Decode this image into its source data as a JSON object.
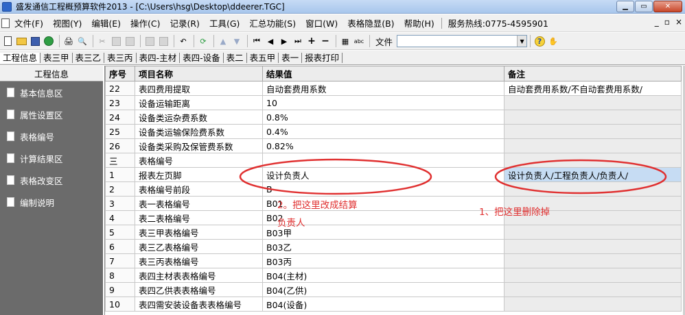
{
  "window": {
    "title": "盛发通信工程概预算软件2013 - [C:\\Users\\hsg\\Desktop\\ddeerer.TGC]",
    "buttons": {
      "minimize": "▁",
      "maximize": "▭",
      "close": "✕"
    }
  },
  "menu": {
    "items": [
      "文件(F)",
      "视图(Y)",
      "编辑(E)",
      "操作(C)",
      "记录(R)",
      "工具(G)",
      "汇总功能(S)",
      "窗口(W)",
      "表格隐显(B)",
      "帮助(H)"
    ],
    "hotline": "服务热线:0775-4595901",
    "mdi_buttons": {
      "minimize": "_",
      "restore": "▫",
      "close": "×"
    }
  },
  "toolbar": {
    "file_label": "文件",
    "file_value": "",
    "icons": [
      "new-icon",
      "open-icon",
      "save-icon",
      "run-icon",
      "print-icon",
      "print-preview-icon",
      "cut-icon",
      "copy-icon",
      "paste-icon",
      "undo-icon",
      "redo-icon",
      "refresh-icon",
      "up-icon",
      "down-icon",
      "first-icon",
      "prev-icon",
      "next-icon",
      "last-icon",
      "add-icon",
      "delete-icon",
      "calc-icon",
      "abc-icon",
      "help-icon",
      "hand-icon"
    ]
  },
  "sheet_tabs": [
    "工程信息",
    "表三甲",
    "表三乙",
    "表三丙",
    "表四-主材",
    "表四-设备",
    "表二",
    "表五甲",
    "表一",
    "报表打印"
  ],
  "sheet_tabs_active": 0,
  "left_panel": {
    "header": "工程信息",
    "items": [
      "基本信息区",
      "属性设置区",
      "表格编号",
      "计算结果区",
      "表格改变区",
      "编制说明"
    ]
  },
  "grid": {
    "columns": [
      "序号",
      "项目名称",
      "结果值",
      "备注"
    ],
    "rows": [
      {
        "no": "22",
        "name": "表四费用提取",
        "value": "自动套费用系数",
        "note": "自动套费用系数/不自动套费用系数/"
      },
      {
        "no": "23",
        "name": "设备运输距离",
        "value": "10",
        "note": ""
      },
      {
        "no": "24",
        "name": "设备类运杂费系数",
        "value": "0.8%",
        "note": ""
      },
      {
        "no": "25",
        "name": "设备类运输保险费系数",
        "value": "0.4%",
        "note": ""
      },
      {
        "no": "26",
        "name": "设备类采购及保管费系数",
        "value": "0.82%",
        "note": ""
      },
      {
        "no": "三",
        "name": "表格编号",
        "value": "",
        "note": ""
      },
      {
        "no": "1",
        "name": "报表左页脚",
        "value": "设计负责人",
        "note": "设计负责人/工程负责人/负责人/"
      },
      {
        "no": "2",
        "name": "表格编号前段",
        "value": "B",
        "note": ""
      },
      {
        "no": "3",
        "name": "表一表格编号",
        "value": "B01",
        "note": ""
      },
      {
        "no": "4",
        "name": "表二表格编号",
        "value": "B02",
        "note": ""
      },
      {
        "no": "5",
        "name": "表三甲表格编号",
        "value": "B03甲",
        "note": ""
      },
      {
        "no": "6",
        "name": "表三乙表格编号",
        "value": "B03乙",
        "note": ""
      },
      {
        "no": "7",
        "name": "表三丙表格编号",
        "value": "B03丙",
        "note": ""
      },
      {
        "no": "8",
        "name": "表四主材表表格编号",
        "value": "B04(主材)",
        "note": ""
      },
      {
        "no": "9",
        "name": "表四乙供表表格编号",
        "value": "B04(乙供)",
        "note": ""
      },
      {
        "no": "10",
        "name": "表四需安装设备表表格编号",
        "value": "B04(设备)",
        "note": ""
      }
    ]
  },
  "annotations": {
    "left_line1": "2。把这里改成结算",
    "left_line2": "负责人",
    "right": "1、把这里删除掉",
    "color": "#e03030"
  }
}
